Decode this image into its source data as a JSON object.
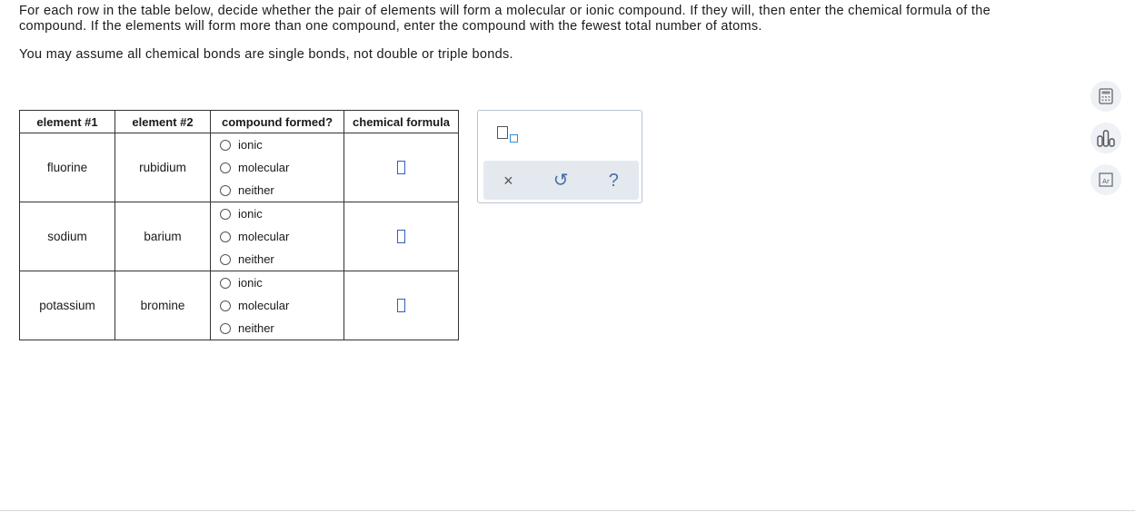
{
  "instructions": {
    "line1": "For each row in the table below, decide whether the pair of elements will form a molecular or ionic compound. If they will, then enter the chemical formula of the compound. If the elements will form more than one compound, enter the compound with the fewest total number of atoms.",
    "line2": "You may assume all chemical bonds are single bonds, not double or triple bonds."
  },
  "table": {
    "headers": [
      "element #1",
      "element #2",
      "compound formed?",
      "chemical formula"
    ],
    "options": [
      "ionic",
      "molecular",
      "neither"
    ],
    "rows": [
      {
        "element1": "fluorine",
        "element2": "rubidium"
      },
      {
        "element1": "sodium",
        "element2": "barium"
      },
      {
        "element1": "potassium",
        "element2": "bromine"
      }
    ]
  },
  "palette": {
    "clear_symbol": "×",
    "undo_symbol": "↺",
    "help_symbol": "?"
  },
  "colors": {
    "accent": "#2f5fb8",
    "panel": "#e4e9f0"
  }
}
